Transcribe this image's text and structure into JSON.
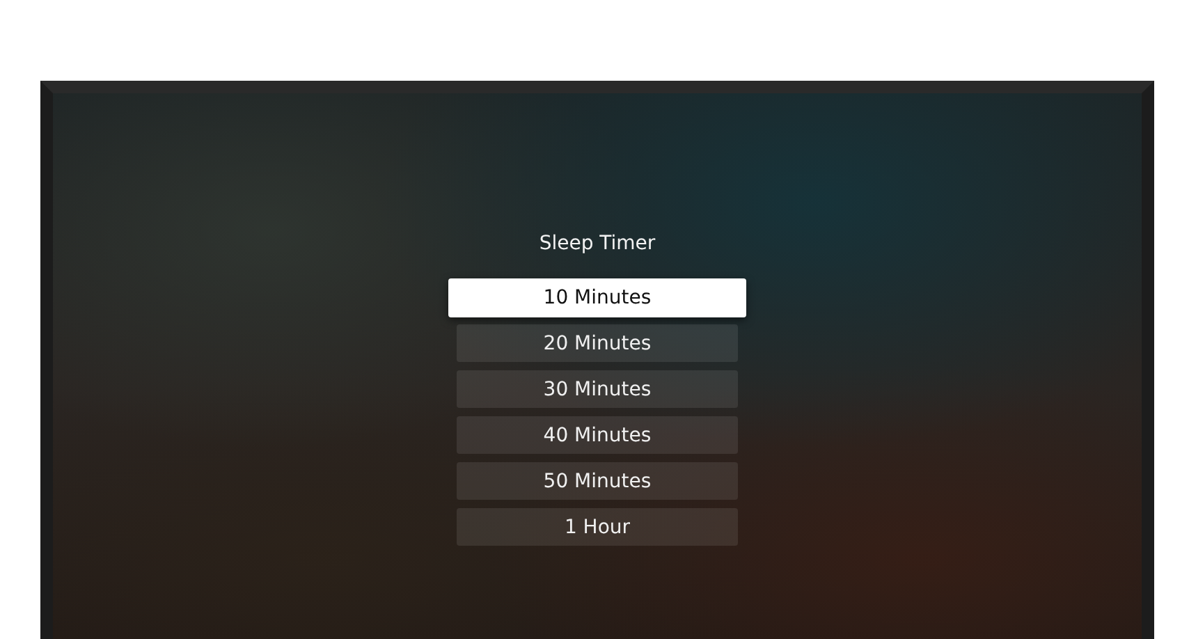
{
  "menu": {
    "title": "Sleep Timer",
    "options": [
      {
        "label": "10 Minutes",
        "selected": true
      },
      {
        "label": "20 Minutes",
        "selected": false
      },
      {
        "label": "30 Minutes",
        "selected": false
      },
      {
        "label": "40 Minutes",
        "selected": false
      },
      {
        "label": "50 Minutes",
        "selected": false
      },
      {
        "label": "1 Hour",
        "selected": false
      }
    ]
  }
}
